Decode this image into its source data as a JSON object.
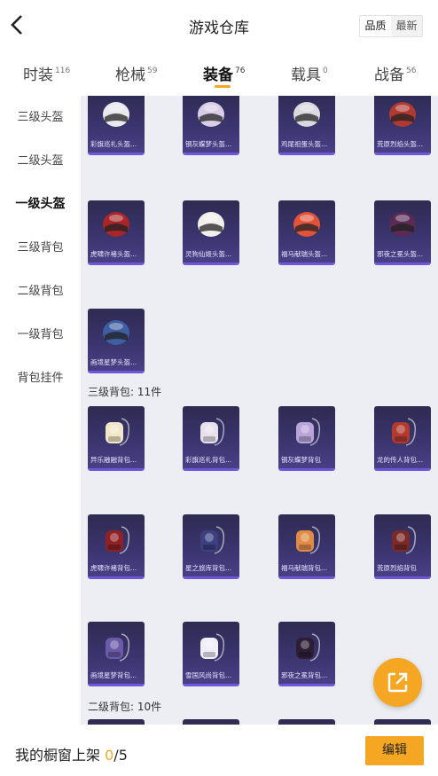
{
  "header": {
    "title": "游戏仓库",
    "sort_options": [
      "品质",
      "最新"
    ],
    "sort_selected": 0
  },
  "tabs": [
    {
      "label": "时装",
      "count": "116"
    },
    {
      "label": "枪械",
      "count": "59"
    },
    {
      "label": "装备",
      "count": "76"
    },
    {
      "label": "载具",
      "count": "0"
    },
    {
      "label": "战备",
      "count": "56"
    }
  ],
  "active_tab": 2,
  "sidebar": {
    "items": [
      "三级头盔",
      "二级头盔",
      "一级头盔",
      "三级背包",
      "二级背包",
      "一级背包",
      "背包挂件"
    ],
    "active": 2
  },
  "sections": [
    {
      "label": "三级背包: 11件"
    },
    {
      "label": "二级背包: 10件"
    }
  ],
  "helmets": [
    {
      "name": "彩旗巡礼头盔...",
      "icon": "helmet-icon",
      "color": "#e9e9ee"
    },
    {
      "name": "钢灰蝶梦头盔...",
      "icon": "helmet-icon",
      "color": "#d8cce6"
    },
    {
      "name": "鸡尾祖蛋头盔...",
      "icon": "helmet-icon",
      "color": "#d9d9df"
    },
    {
      "name": "荒原烈焰头盔...",
      "icon": "helmet-icon",
      "color": "#b03a32"
    },
    {
      "name": "虎啸许褚头盔...",
      "icon": "helmet-icon",
      "color": "#a8262a"
    },
    {
      "name": "灵狗仙姬头盔...",
      "icon": "helmet-icon",
      "color": "#f1efe9"
    },
    {
      "name": "福马献瑞头盔...",
      "icon": "helmet-icon",
      "color": "#e0533a"
    },
    {
      "name": "邪夜之冕头盔...",
      "icon": "helmet-icon",
      "color": "#5a2a55"
    },
    {
      "name": "画境星梦头盔...",
      "icon": "helmet-icon",
      "color": "#3d5ea0"
    }
  ],
  "backpacks_lv3": [
    {
      "name": "异乐融融背包...",
      "icon": "backpack-icon",
      "color": "#f2e7c9"
    },
    {
      "name": "彩旗巡礼背包...",
      "icon": "backpack-icon",
      "color": "#e7e1ec"
    },
    {
      "name": "钢灰蝶梦背包",
      "icon": "backpack-icon",
      "color": "#b9a4d8"
    },
    {
      "name": "龙的传人背包...",
      "icon": "backpack-icon",
      "color": "#b23a2f"
    },
    {
      "name": "虎啸许褚背包...",
      "icon": "backpack-icon",
      "color": "#8e2126"
    },
    {
      "name": "星之旅库背包...",
      "icon": "backpack-icon",
      "color": "#3c3f80"
    },
    {
      "name": "福马献瑞背包...",
      "icon": "backpack-icon",
      "color": "#e08c46"
    },
    {
      "name": "荒原烈焰背包",
      "icon": "backpack-icon",
      "color": "#7a2a28"
    },
    {
      "name": "画境星梦背包...",
      "icon": "backpack-icon",
      "color": "#6a5aa8"
    },
    {
      "name": "雪国风尚背包...",
      "icon": "backpack-icon",
      "color": "#f1eef8"
    },
    {
      "name": "邪夜之冕背包...",
      "icon": "backpack-icon",
      "color": "#2d1e36"
    }
  ],
  "bottom": {
    "shelf_label": "我的橱窗上架",
    "shelf_count": "0",
    "shelf_total": "/5",
    "edit_label": "编辑"
  },
  "accent": "#f5a623"
}
